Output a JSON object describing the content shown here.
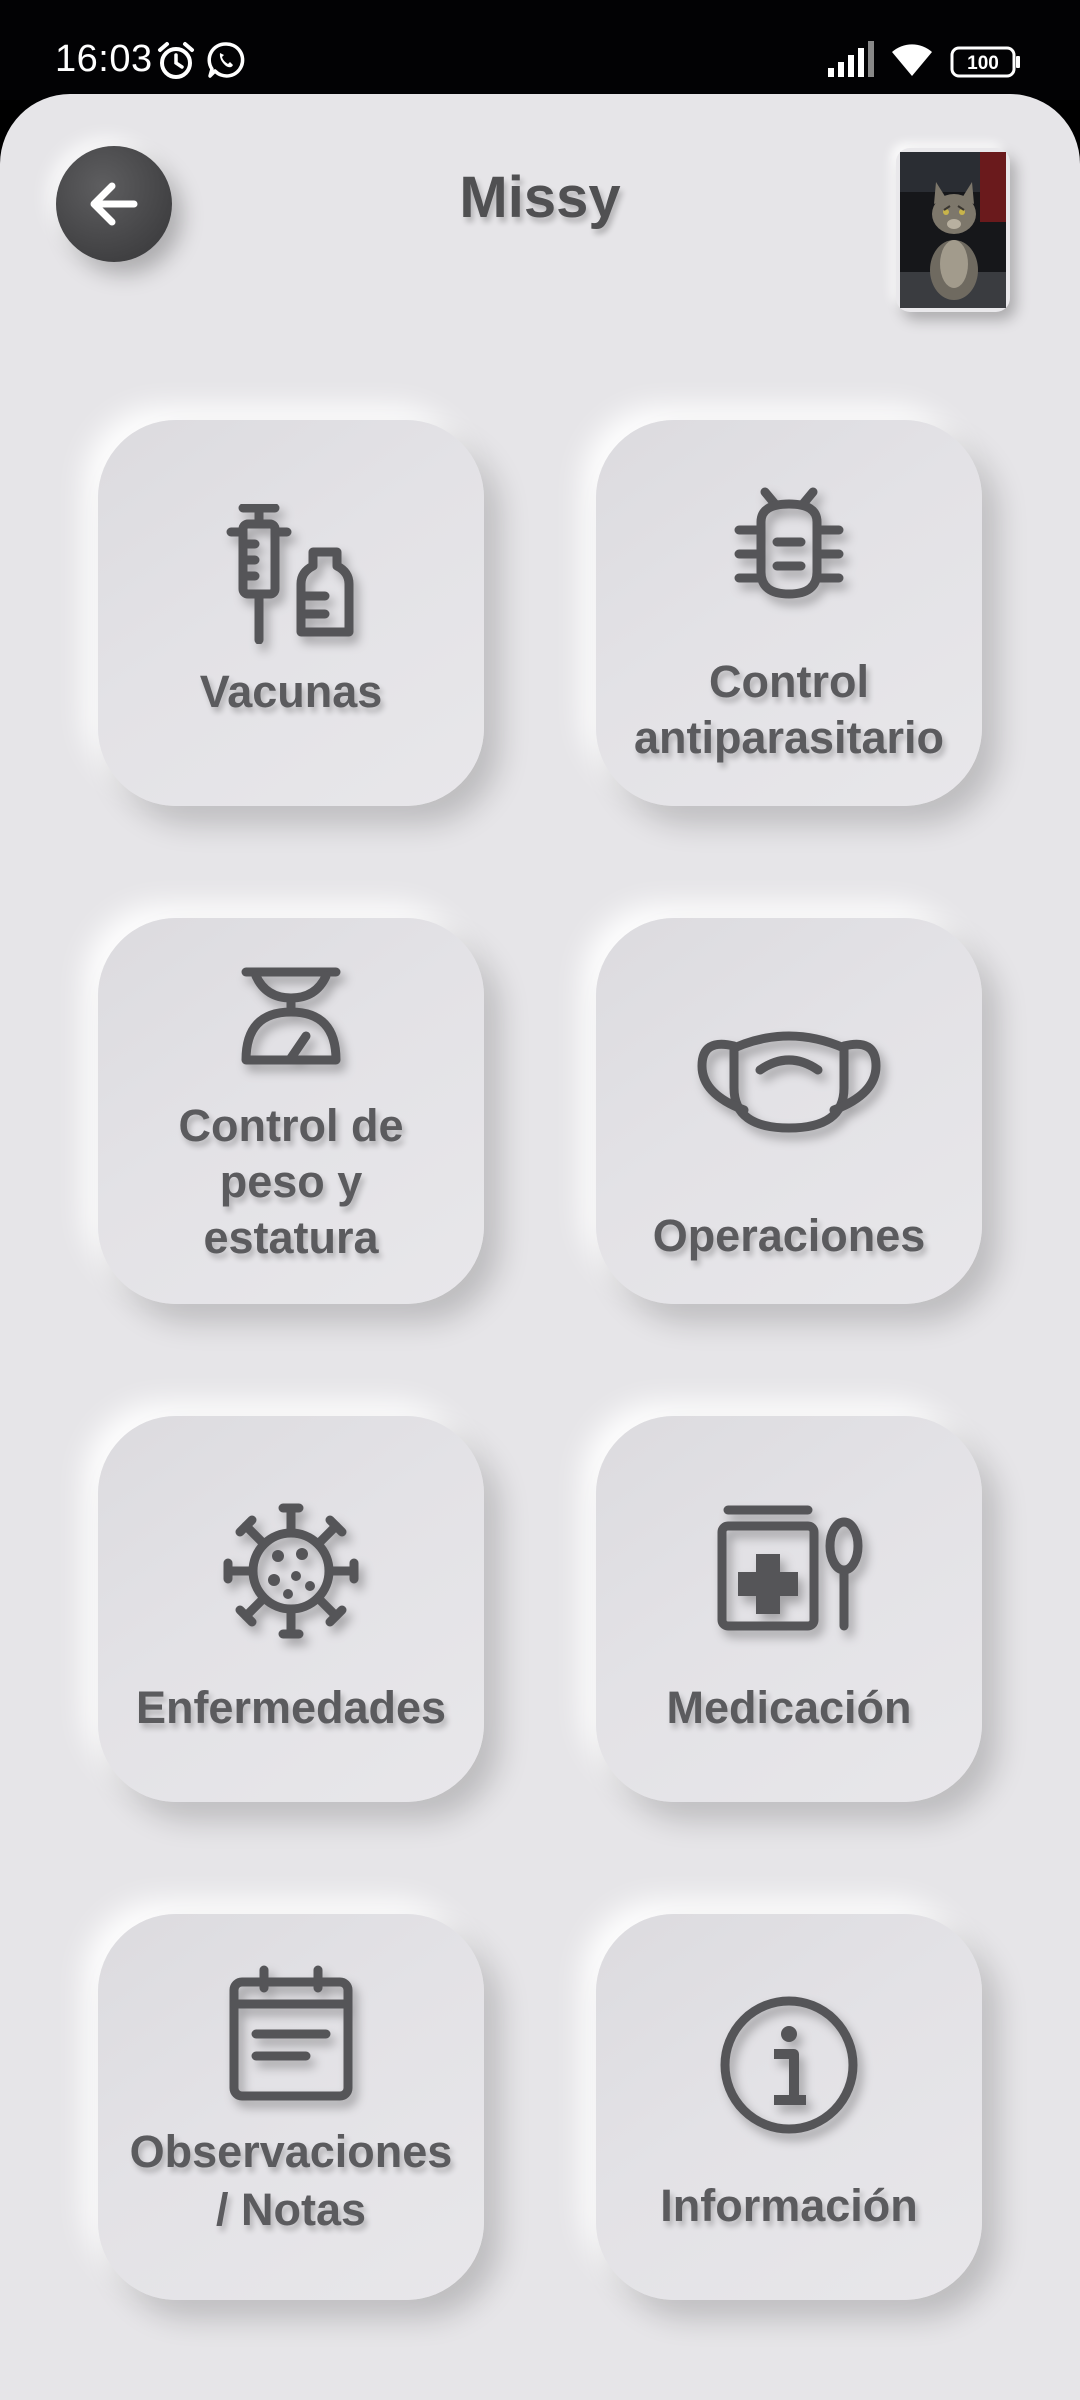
{
  "status_bar": {
    "time": "16:03",
    "battery": "100",
    "icons": [
      "alarm-icon",
      "whatsapp-icon",
      "signal-icon",
      "wifi-icon",
      "battery-icon"
    ]
  },
  "header": {
    "title": "Missy",
    "back_icon": "arrow-left-icon",
    "avatar": "cat-photo"
  },
  "menu": {
    "vacunas": "Vacunas",
    "antiparasitario_1": "Control",
    "antiparasitario_2": "antiparasitario",
    "peso_1": "Control de",
    "peso_2": "peso y",
    "peso_3": "estatura",
    "operaciones": "Operaciones",
    "enfermedades": "Enfermedades",
    "medicacion": "Medicación",
    "observaciones_1": "Observaciones",
    "observaciones_2": "/ Notas",
    "informacion": "Información"
  },
  "colors": {
    "background": "#e6e5e8",
    "icon": "#555558",
    "text": "#5b5b5e"
  }
}
